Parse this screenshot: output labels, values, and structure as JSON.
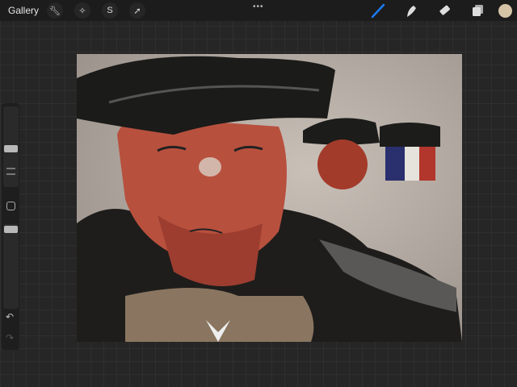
{
  "topbar": {
    "gallery": "Gallery",
    "left_tools": [
      "wrench-icon",
      "magic-wand-icon",
      "selection-icon",
      "transform-icon"
    ],
    "more": "•••",
    "right_tools": [
      "brush-icon",
      "smudge-icon",
      "eraser-icon",
      "layers-icon"
    ],
    "accent": "#1a7cf5",
    "current_color": "#d6c4a6"
  },
  "sidebar": {
    "brush_size": 0.55,
    "opacity": 0.7
  }
}
